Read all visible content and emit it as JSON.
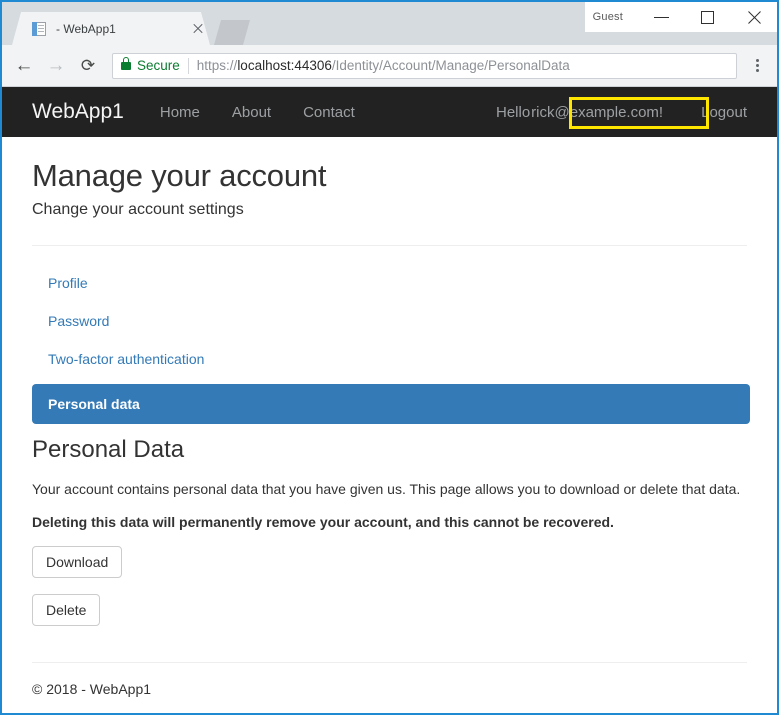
{
  "browser": {
    "tab": {
      "title": "- WebApp1",
      "favicon": "page-icon",
      "close_icon": "close-icon"
    },
    "new_tab_icon": "new-tab-icon",
    "window": {
      "profile_label": "Guest",
      "minimize_icon": "minimize-icon",
      "maximize_icon": "maximize-icon",
      "close_icon": "close-icon"
    },
    "toolbar": {
      "back_icon": "back-arrow-icon",
      "forward_icon": "forward-arrow-icon",
      "reload_icon": "reload-icon",
      "lock_icon": "lock-icon",
      "security_label": "Secure",
      "url_scheme": "https://",
      "url_host": "localhost:44306",
      "url_path": "/Identity/Account/Manage/PersonalData",
      "url_full": "https://localhost:44306/Identity/Account/Manage/PersonalData",
      "menu_icon": "more-vertical-icon"
    }
  },
  "site_nav": {
    "brand": "WebApp1",
    "links": [
      {
        "label": "Home"
      },
      {
        "label": "About"
      },
      {
        "label": "Contact"
      }
    ],
    "greeting": "Hello",
    "user_email": "rick@example.com!",
    "logout": "Logout",
    "highlight_color": "#ffe600"
  },
  "page": {
    "title": "Manage your account",
    "subtitle": "Change your account settings",
    "side_nav": [
      {
        "label": "Profile",
        "active": false
      },
      {
        "label": "Password",
        "active": false
      },
      {
        "label": "Two-factor authentication",
        "active": false
      },
      {
        "label": "Personal data",
        "active": true
      }
    ],
    "section_title": "Personal Data",
    "body_text": "Your account contains personal data that you have given us. This page allows you to download or delete that data.",
    "warning_text": "Deleting this data will permanently remove your account, and this cannot be recovered.",
    "buttons": [
      {
        "label": "Download"
      },
      {
        "label": "Delete"
      }
    ],
    "footer": "© 2018 - WebApp1"
  },
  "colors": {
    "navbar_bg": "#222222",
    "active_link_bg": "#337ab7",
    "link_color": "#337ab7",
    "secure_green": "#0b7c30",
    "window_border": "#1f8ad2"
  }
}
